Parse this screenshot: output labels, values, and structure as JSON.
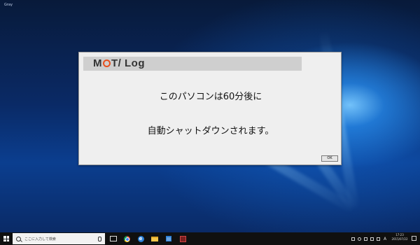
{
  "desktop": {
    "corner_label": "Gray"
  },
  "dialog": {
    "logo_text_pre": "M",
    "logo_text_post": "T/ Log",
    "message_line1": "このパソコンは60分後に",
    "message_line2": "自動シャットダウンされます。",
    "ok_label": "OK",
    "logo_accent_color": "#e8501e"
  },
  "taskbar": {
    "search_placeholder": "ここに入力して検索",
    "ime_label": "A",
    "clock_time": "17:23",
    "clock_date": "2015/07/22",
    "pinned_icons": [
      "task-view-icon",
      "chrome-icon",
      "edge-icon",
      "file-explorer-icon",
      "store-icon",
      "app-icon"
    ]
  }
}
